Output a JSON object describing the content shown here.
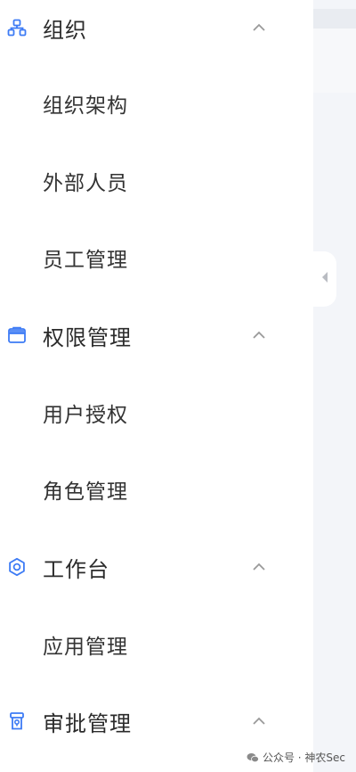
{
  "sidebar": {
    "groups": [
      {
        "label": "组织",
        "icon": "org-structure-icon",
        "expanded": true,
        "items": [
          "组织架构",
          "外部人员",
          "员工管理"
        ]
      },
      {
        "label": "权限管理",
        "icon": "permission-box-icon",
        "expanded": true,
        "items": [
          "用户授权",
          "角色管理"
        ]
      },
      {
        "label": "工作台",
        "icon": "gear-icon",
        "expanded": true,
        "items": [
          "应用管理"
        ]
      },
      {
        "label": "审批管理",
        "icon": "approval-stamp-icon",
        "expanded": true,
        "items": []
      }
    ]
  },
  "collapse_handle": {
    "icon": "caret-left-icon"
  },
  "watermark": {
    "text": "公众号 · 神农Sec",
    "icon": "wechat-icon"
  },
  "colors": {
    "accent": "#3d7bf5",
    "text": "#2b2b2b",
    "chevron": "#9a9a9a",
    "content_bg": "#f3f5f9"
  }
}
